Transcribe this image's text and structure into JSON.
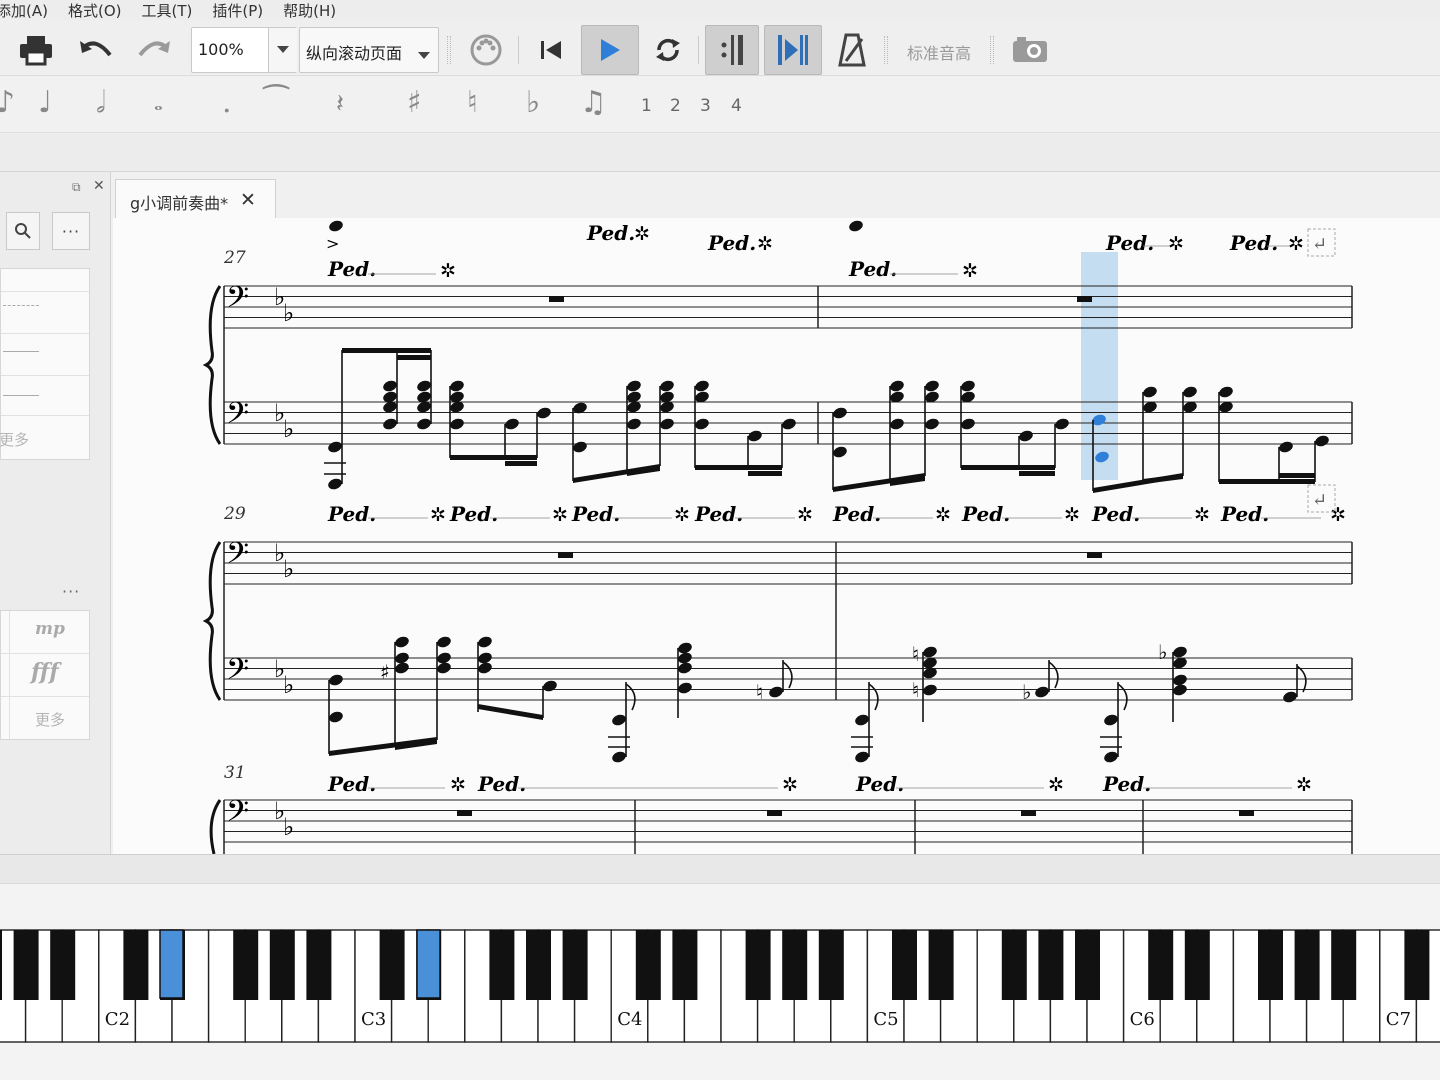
{
  "menu": [
    "添加(A)",
    "格式(O)",
    "工具(T)",
    "插件(P)",
    "帮助(H)"
  ],
  "toolbar": {
    "zoom_value": "100%",
    "view_mode": "纵向滚动页面",
    "concert_pitch_label": "标准音高",
    "accent_color": "#2f7fd8"
  },
  "note_input": {
    "voices": [
      "1",
      "2",
      "3",
      "4"
    ]
  },
  "palette": {
    "dynamics": [
      "mp",
      "fff"
    ],
    "more_label": "更多",
    "more_label_top": "更多",
    "dots": "···"
  },
  "tab": {
    "title": "g小调前奏曲*"
  },
  "score": {
    "measure_numbers": [
      "27",
      "29",
      "31"
    ],
    "pedal_mark": "Ped.",
    "highlight_color": "#b8d6ee",
    "selected_note_color": "#2f7fd8"
  },
  "piano": {
    "octave_labels": [
      "C2",
      "C3",
      "C4",
      "C5",
      "C6",
      "C7"
    ],
    "highlight_color": "#4a90d9"
  }
}
